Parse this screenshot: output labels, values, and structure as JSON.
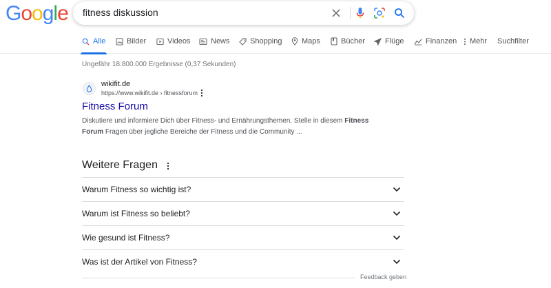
{
  "logo": {
    "letters": [
      "G",
      "o",
      "o",
      "g",
      "l",
      "e"
    ],
    "colors": [
      "#4285f4",
      "#ea4335",
      "#fbbc05",
      "#4285f4",
      "#34a853",
      "#ea4335"
    ]
  },
  "search": {
    "query": "fitness diskussion",
    "icons": [
      "close-icon",
      "microphone-icon",
      "lens-icon",
      "search-icon"
    ]
  },
  "tabs": [
    {
      "label": "Alle",
      "icon": "search-icon",
      "active": true
    },
    {
      "label": "Bilder",
      "icon": "image-icon"
    },
    {
      "label": "Videos",
      "icon": "video-icon"
    },
    {
      "label": "News",
      "icon": "news-icon"
    },
    {
      "label": "Shopping",
      "icon": "tag-icon"
    },
    {
      "label": "Maps",
      "icon": "map-pin-icon"
    },
    {
      "label": "Bücher",
      "icon": "book-icon"
    },
    {
      "label": "Flüge",
      "icon": "plane-icon"
    },
    {
      "label": "Finanzen",
      "icon": "finance-icon"
    },
    {
      "label": "Mehr",
      "icon": "more-icon"
    }
  ],
  "tools_label": "Suchfilter",
  "stats": "Ungefähr 18.800.000 Ergebnisse (0,37 Sekunden)",
  "result": {
    "site_name": "wikifit.de",
    "url": "https://www.wikifit.de › fitnessforum",
    "title": "Fitness Forum",
    "snippet": {
      "part1": "Diskutiere und informiere Dich über Fitness- und Ernährungsthemen. Stelle in diesem ",
      "bold1": "Fitness",
      "part2": " ",
      "bold2": "Forum",
      "part3": " Fragen über jegliche Bereiche der Fitness und die Community ..."
    }
  },
  "paa": {
    "heading": "Weitere Fragen",
    "questions": [
      "Warum Fitness so wichtig ist?",
      "Warum ist Fitness so beliebt?",
      "Wie gesund ist Fitness?",
      "Was ist der Artikel von Fitness?"
    ]
  },
  "feedback_label": "Feedback geben",
  "colors": {
    "accent": "#1a73e8",
    "link": "#1a0dab",
    "text_secondary": "#4d5156"
  }
}
